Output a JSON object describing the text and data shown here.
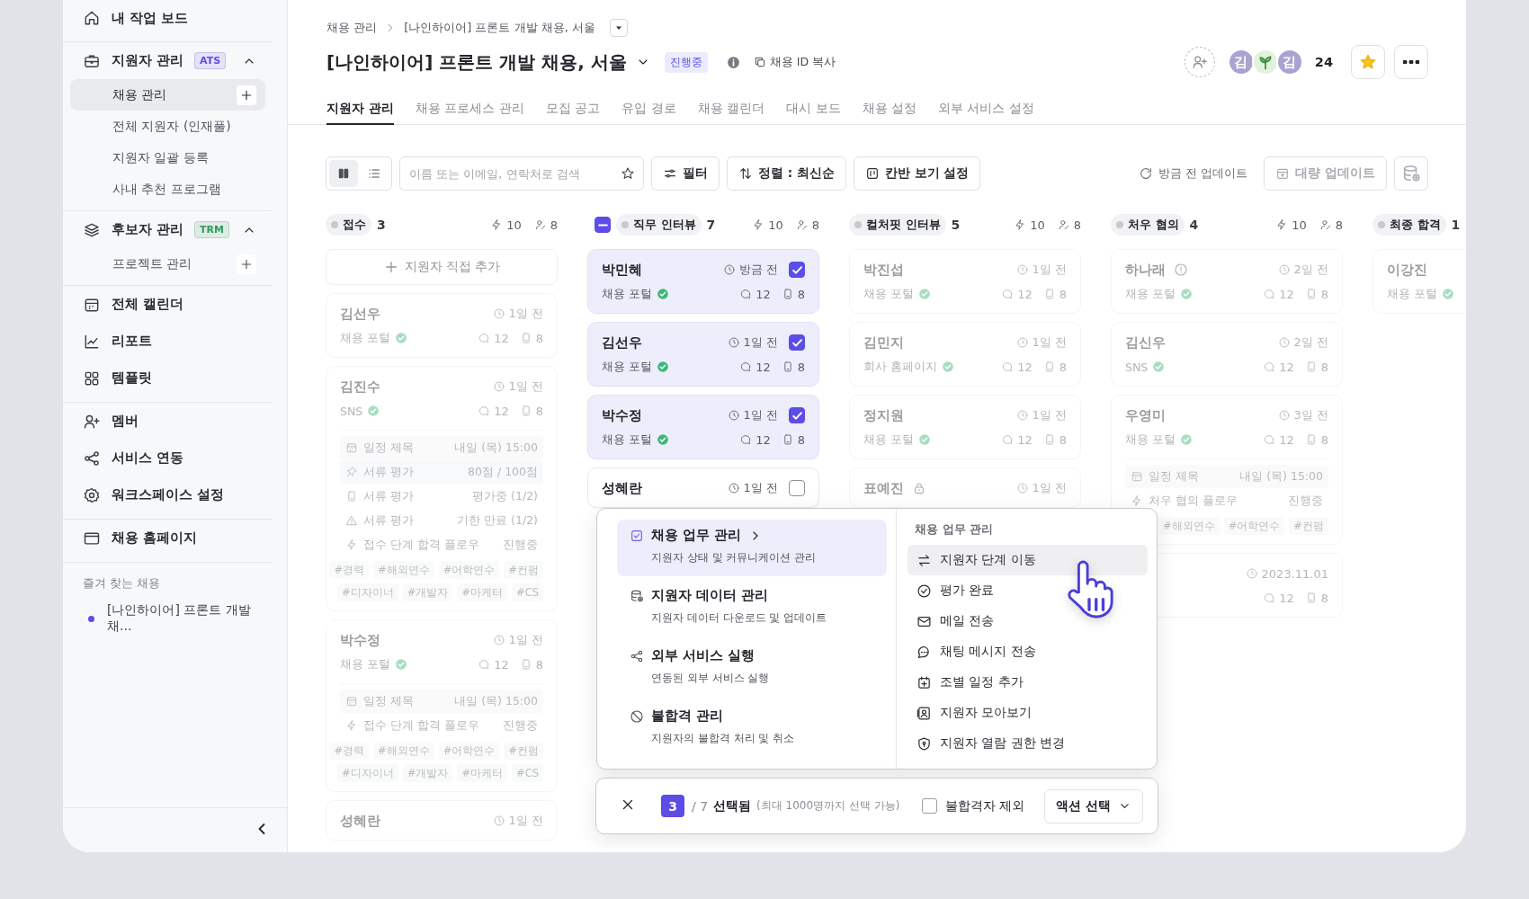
{
  "sidebar": {
    "groups": [
      {
        "items": [
          {
            "label": "내 작업 보드"
          }
        ]
      },
      {
        "items": [
          {
            "label": "지원자 관리",
            "badge": {
              "text": "ATS",
              "color": "#5b50e0"
            },
            "expanded": true,
            "children": [
              {
                "label": "채용 관리",
                "selected": true,
                "addable": true
              },
              {
                "label": "전체 지원자 (인재풀)",
                "selected": false
              },
              {
                "label": "지원자 일괄 등록",
                "selected": false
              },
              {
                "label": "사내 추천 프로그램",
                "selected": false
              }
            ]
          }
        ]
      },
      {
        "items": [
          {
            "label": "후보자 관리",
            "badge": {
              "text": "TRM",
              "color": "#2e9a5c"
            },
            "expanded": true,
            "children": [
              {
                "label": "프로젝트 관리",
                "selected": false,
                "addable": true
              }
            ]
          }
        ]
      },
      {
        "items": [
          {
            "label": "전체 캘린더"
          },
          {
            "label": "리포트"
          },
          {
            "label": "템플릿"
          }
        ]
      },
      {
        "items": [
          {
            "label": "멤버"
          },
          {
            "label": "서비스 연동"
          },
          {
            "label": "워크스페이스 설정"
          }
        ]
      },
      {
        "items": [
          {
            "label": "채용 홈페이지"
          }
        ]
      }
    ],
    "favorites": {
      "heading": "즐겨 찾는 채용",
      "items": [
        {
          "label": "[나인하이어] 프론트 개발 채...",
          "color": "#5b4de6"
        }
      ]
    }
  },
  "breadcrumb": [
    "채용 관리",
    "[나인하이어] 프론트 개발 채용, 서울"
  ],
  "header": {
    "title": "[나인하이어] 프론트 개발 채용, 서울",
    "status": "진행중",
    "copy_label": "채용 ID 복사",
    "members": [
      {
        "kind": "letter",
        "initial": "김"
      },
      {
        "kind": "plant"
      },
      {
        "kind": "letter",
        "initial": "김"
      }
    ],
    "member_count": "24",
    "starred": true
  },
  "tabs": [
    {
      "label": "지원자 관리",
      "selected": true
    },
    {
      "label": "채용 프로세스 관리",
      "selected": false
    },
    {
      "label": "모집 공고",
      "selected": false
    },
    {
      "label": "유입 경로",
      "selected": false
    },
    {
      "label": "채용 캘린더",
      "selected": false
    },
    {
      "label": "대시 보드",
      "selected": false
    },
    {
      "label": "채용 설정",
      "selected": false
    },
    {
      "label": "외부 서비스 설정",
      "selected": false
    }
  ],
  "toolbar": {
    "views": [
      {
        "kind": "kanban",
        "selected": true
      },
      {
        "kind": "list",
        "selected": false
      }
    ],
    "search": {
      "placeholder": "이름 또는 이메일, 연락처로 검색"
    },
    "buttons": [
      {
        "kind": "filter",
        "label": "필터"
      },
      {
        "kind": "sort",
        "label": "정렬 : 최신순"
      },
      {
        "kind": "board",
        "label": "칸반 보기 설정"
      }
    ],
    "updated": "방금 전 업데이트",
    "bulk_update": {
      "label": "대량 업데이트",
      "disabled": true
    }
  },
  "columns": [
    {
      "name": "접수",
      "count": "3",
      "actions": "10",
      "people": "8",
      "dimmed": true,
      "add_label": "지원자 직접 추가",
      "cards": [
        {
          "name": "김선우",
          "time": "1일 전",
          "source": "채용 포털",
          "verified": true,
          "comments": "12",
          "docs": "8"
        },
        {
          "name": "김진수",
          "time": "1일 전",
          "source": "SNS",
          "verified": true,
          "comments": "12",
          "docs": "8",
          "details": [
            {
              "kind": "schedule",
              "label": "일정 제목",
              "value": "내일 (목) 15:00"
            },
            {
              "kind": "score",
              "label": "서류 평가",
              "value": "80점 / 100점"
            },
            {
              "kind": "evaluating",
              "label": "서류 평가",
              "value": "평가중 (1/2)"
            },
            {
              "kind": "expired",
              "label": "서류 평가",
              "value": "기한 만료 (1/2)"
            },
            {
              "kind": "flow",
              "label": "접수 단계 합격 플로우",
              "value": "진행중"
            }
          ],
          "tags": [
            [
              "#경력",
              "#해외연수",
              "#어학연수",
              "#컨펌"
            ],
            [
              "#디자이너",
              "#개발자",
              "#마케터",
              "#CS"
            ]
          ]
        },
        {
          "name": "박수정",
          "time": "1일 전",
          "source": "채용 포털",
          "verified": true,
          "comments": "12",
          "docs": "8",
          "details": [
            {
              "kind": "schedule",
              "label": "일정 제목",
              "value": "내일 (목) 15:00"
            },
            {
              "kind": "flow",
              "label": "접수 단계 합격 플로우",
              "value": "진행중"
            }
          ],
          "tags": [
            [
              "#경력",
              "#해외연수",
              "#어학연수",
              "#컨펌"
            ],
            [
              "#디자이너",
              "#개발자",
              "#마케터",
              "#CS"
            ]
          ]
        },
        {
          "name": "성혜란",
          "time": "1일 전"
        }
      ]
    },
    {
      "name": "직무 인터뷰",
      "count": "7",
      "actions": "10",
      "people": "8",
      "dimmed": false,
      "indeterminate": true,
      "cards": [
        {
          "name": "박민혜",
          "time": "방금 전",
          "checked": true,
          "source": "채용 포털",
          "verified": true,
          "comments": "12",
          "docs": "8"
        },
        {
          "name": "김선우",
          "time": "1일 전",
          "checked": true,
          "source": "채용 포털",
          "verified": true,
          "comments": "12",
          "docs": "8"
        },
        {
          "name": "박수정",
          "time": "1일 전",
          "checked": true,
          "source": "채용 포털",
          "verified": true,
          "comments": "12",
          "docs": "8"
        },
        {
          "name": "성혜란",
          "time": "1일 전",
          "checked": false
        }
      ]
    },
    {
      "name": "컬처핏 인터뷰",
      "count": "5",
      "actions": "10",
      "people": "8",
      "dimmed": true,
      "cards": [
        {
          "name": "박진섭",
          "time": "1일 전",
          "source": "채용 포털",
          "verified": true,
          "comments": "12",
          "docs": "8"
        },
        {
          "name": "김민지",
          "time": "1일 전",
          "source": "회사 홈페이지",
          "verified": true,
          "comments": "12",
          "docs": "8"
        },
        {
          "name": "정지원",
          "time": "1일 전",
          "source": "채용 포털",
          "verified": true,
          "comments": "12",
          "docs": "8"
        },
        {
          "name": "표예진",
          "locked": true,
          "time": "1일 전"
        }
      ]
    },
    {
      "name": "처우 협의",
      "count": "4",
      "actions": "10",
      "people": "8",
      "dimmed": true,
      "cards": [
        {
          "name": "하나래",
          "warning": true,
          "time": "2일 전",
          "source": "채용 포털",
          "verified": true,
          "comments": "12",
          "docs": "8"
        },
        {
          "name": "김신우",
          "time": "2일 전",
          "source": "SNS",
          "verified": true,
          "comments": "12",
          "docs": "8"
        },
        {
          "name": "우영미",
          "time": "3일 전",
          "source": "채용 포털",
          "verified": true,
          "comments": "12",
          "docs": "8",
          "details": [
            {
              "kind": "schedule",
              "label": "일정 제목",
              "value": "내일 (목) 15:00"
            },
            {
              "kind": "flow",
              "label": "처우 협의 플로우",
              "value": "진행중"
            }
          ],
          "tags": [
            [
              "#해외연수",
              "#어학연수",
              "#컨펌"
            ]
          ]
        },
        {
          "time": "2023.11.01",
          "comments": "12",
          "docs": "8"
        }
      ]
    },
    {
      "name": "최종 합격",
      "count": "1",
      "dimmed": true,
      "cards": [
        {
          "name": "이강진",
          "source": "채용 포털",
          "verified": true
        }
      ]
    }
  ],
  "action_menu": {
    "categories": [
      {
        "title": "채용 업무 관리",
        "description": "지원자 상태 및 커뮤니케이션 관리",
        "selected": true
      },
      {
        "title": "지원자 데이터 관리",
        "description": "지원자 데이터 다운로드 및 업데이트",
        "selected": false
      },
      {
        "title": "외부 서비스 실행",
        "description": "연동된 외부 서비스 실행",
        "selected": false
      },
      {
        "title": "불합격 관리",
        "description": "지원자의 불합격 처리 및 취소",
        "selected": false
      }
    ],
    "submenu": {
      "heading": "채용 업무 관리",
      "items": [
        {
          "label": "지원자 단계 이동",
          "hovered": true
        },
        {
          "label": "평가 완료",
          "hovered": false
        },
        {
          "label": "메일 전송",
          "hovered": false
        },
        {
          "label": "채팅 메시지 전송",
          "hovered": false
        },
        {
          "label": "조별 일정 추가",
          "hovered": false
        },
        {
          "label": "지원자 모아보기",
          "hovered": false
        },
        {
          "label": "지원자 열람 권한 변경",
          "hovered": false
        }
      ]
    }
  },
  "selection_bar": {
    "selected": "3",
    "total": "/ 7",
    "label": "선택됨",
    "hint": "(최대 1000명까지 선택 가능)",
    "exclude": {
      "label": "불합격자 제외",
      "checked": false
    },
    "action": "액션 선택"
  }
}
